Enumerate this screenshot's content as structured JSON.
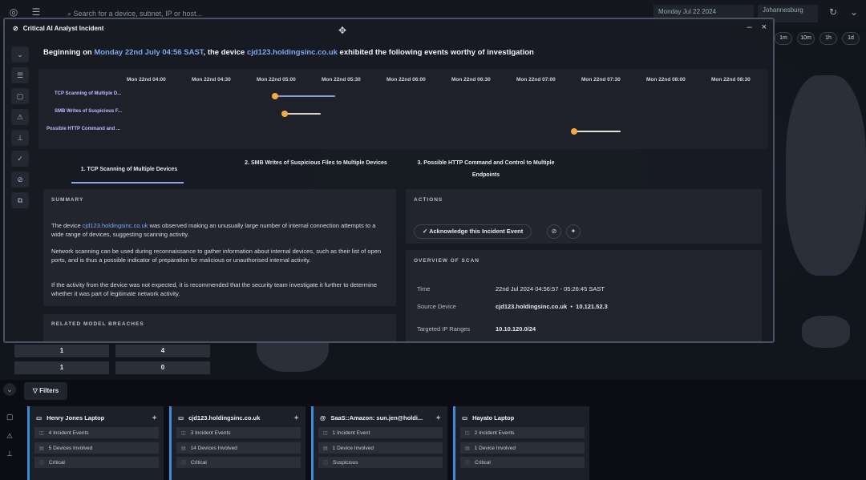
{
  "topbar": {
    "search_placeholder": "Search for a device, subnet, IP or host...",
    "date": "Monday Jul 22 2024",
    "city": "Johannesburg"
  },
  "zoom_buttons": [
    "1m",
    "10m",
    "1h",
    "1d"
  ],
  "bg_counts": [
    "1",
    "4",
    "1",
    "0"
  ],
  "filters_label": "Filters",
  "modal": {
    "title": "Critical AI Analyst Incident",
    "headline_prefix": "Beginning on ",
    "headline_date": "Monday 22nd July 04:56 SAST",
    "headline_mid": ", the device ",
    "headline_device": "cjd123.holdingsinc.co.uk",
    "headline_suffix": " exhibited the following events worthy of investigation",
    "timeline": {
      "times": [
        "Mon 22nd 04:00",
        "Mon 22nd 04:30",
        "Mon 22nd 05:00",
        "Mon 22nd 05:30",
        "Mon 22nd 06:00",
        "Mon 22nd 06:30",
        "Mon 22nd 07:00",
        "Mon 22nd 07:30",
        "Mon 22nd 08:00",
        "Mon 22nd 08:30"
      ],
      "rows": [
        "TCP Scanning of Multiple D...",
        "SMB Writes of Suspicious F...",
        "Possible HTTP Command and ..."
      ]
    },
    "tabs": [
      "1. TCP Scanning of Multiple Devices",
      "2. SMB Writes of Suspicious Files to Multiple Devices",
      "3. Possible HTTP Command and Control to Multiple Endpoints"
    ],
    "summary": {
      "header": "SUMMARY",
      "p1_prefix": "The device ",
      "p1_device": "cjd123.holdingsinc.co.uk",
      "p1_suffix": " was observed making an unusually large number of internal connection attempts to a wide range of devices, suggesting scanning activity.",
      "p2": "Network scanning can be used during reconnaissance to gather information about internal devices, such as their list of open ports, and is thus a possible indicator of preparation for malicious or unauthorised internal activity.",
      "p3": "If the activity from the device was not expected, it is recommended that the security team investigate it further to determine whether it was part of legitimate network activity."
    },
    "related_header": "RELATED MODEL BREACHES",
    "actions": {
      "header": "ACTIONS",
      "ack_label": "Acknowledge this Incident Event"
    },
    "overview": {
      "header": "OVERVIEW OF SCAN",
      "time_label": "Time",
      "time_value": "22nd Jul 2024 04:56:57 - 05:26:45 SAST",
      "source_label": "Source Device",
      "source_host": "cjd123.holdingsinc.co.uk",
      "source_ip": "10.121.52.3",
      "targeted_label": "Targeted IP Ranges",
      "targeted_value": "10.10.120.0/24"
    }
  },
  "cards": [
    {
      "title": "Henry Jones Laptop",
      "r1": "4 Incident Events",
      "r2": "5 Devices Involved",
      "r3": "Critical",
      "icon": "laptop-icon"
    },
    {
      "title": "cjd123.holdingsinc.co.uk",
      "r1": "3 Incident Events",
      "r2": "14 Devices Involved",
      "r3": "Critical",
      "icon": "desktop-icon"
    },
    {
      "title": "SaaS::Amazon: sun.jen@holdi...",
      "r1": "1 Incident Event",
      "r2": "1 Device Involved",
      "r3": "Suspicious",
      "icon": "at-icon"
    },
    {
      "title": "Hayato Laptop",
      "r1": "2 Incident Events",
      "r2": "1 Device Involved",
      "r3": "Critical",
      "icon": "laptop-icon"
    }
  ]
}
